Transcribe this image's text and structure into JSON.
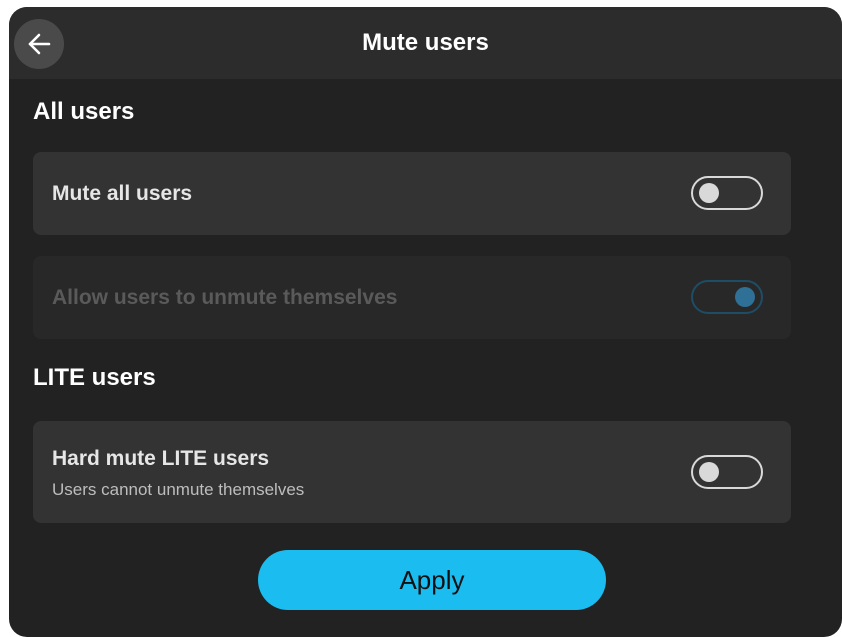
{
  "window": {
    "title": "Mute users"
  },
  "sections": {
    "all_users": {
      "heading": "All users",
      "mute_all": {
        "label": "Mute all users",
        "enabled": false
      },
      "allow_unmute": {
        "label": "Allow users to unmute themselves",
        "enabled": true,
        "disabled": true
      }
    },
    "lite_users": {
      "heading": "LITE users",
      "hard_mute": {
        "label": "Hard mute LITE users",
        "sublabel": "Users cannot unmute themselves",
        "enabled": false
      }
    }
  },
  "actions": {
    "apply_label": "Apply"
  },
  "colors": {
    "accent": "#1bbcef",
    "background": "#222222",
    "row": "#333333"
  },
  "icons": {
    "back": "arrow-left-icon"
  }
}
